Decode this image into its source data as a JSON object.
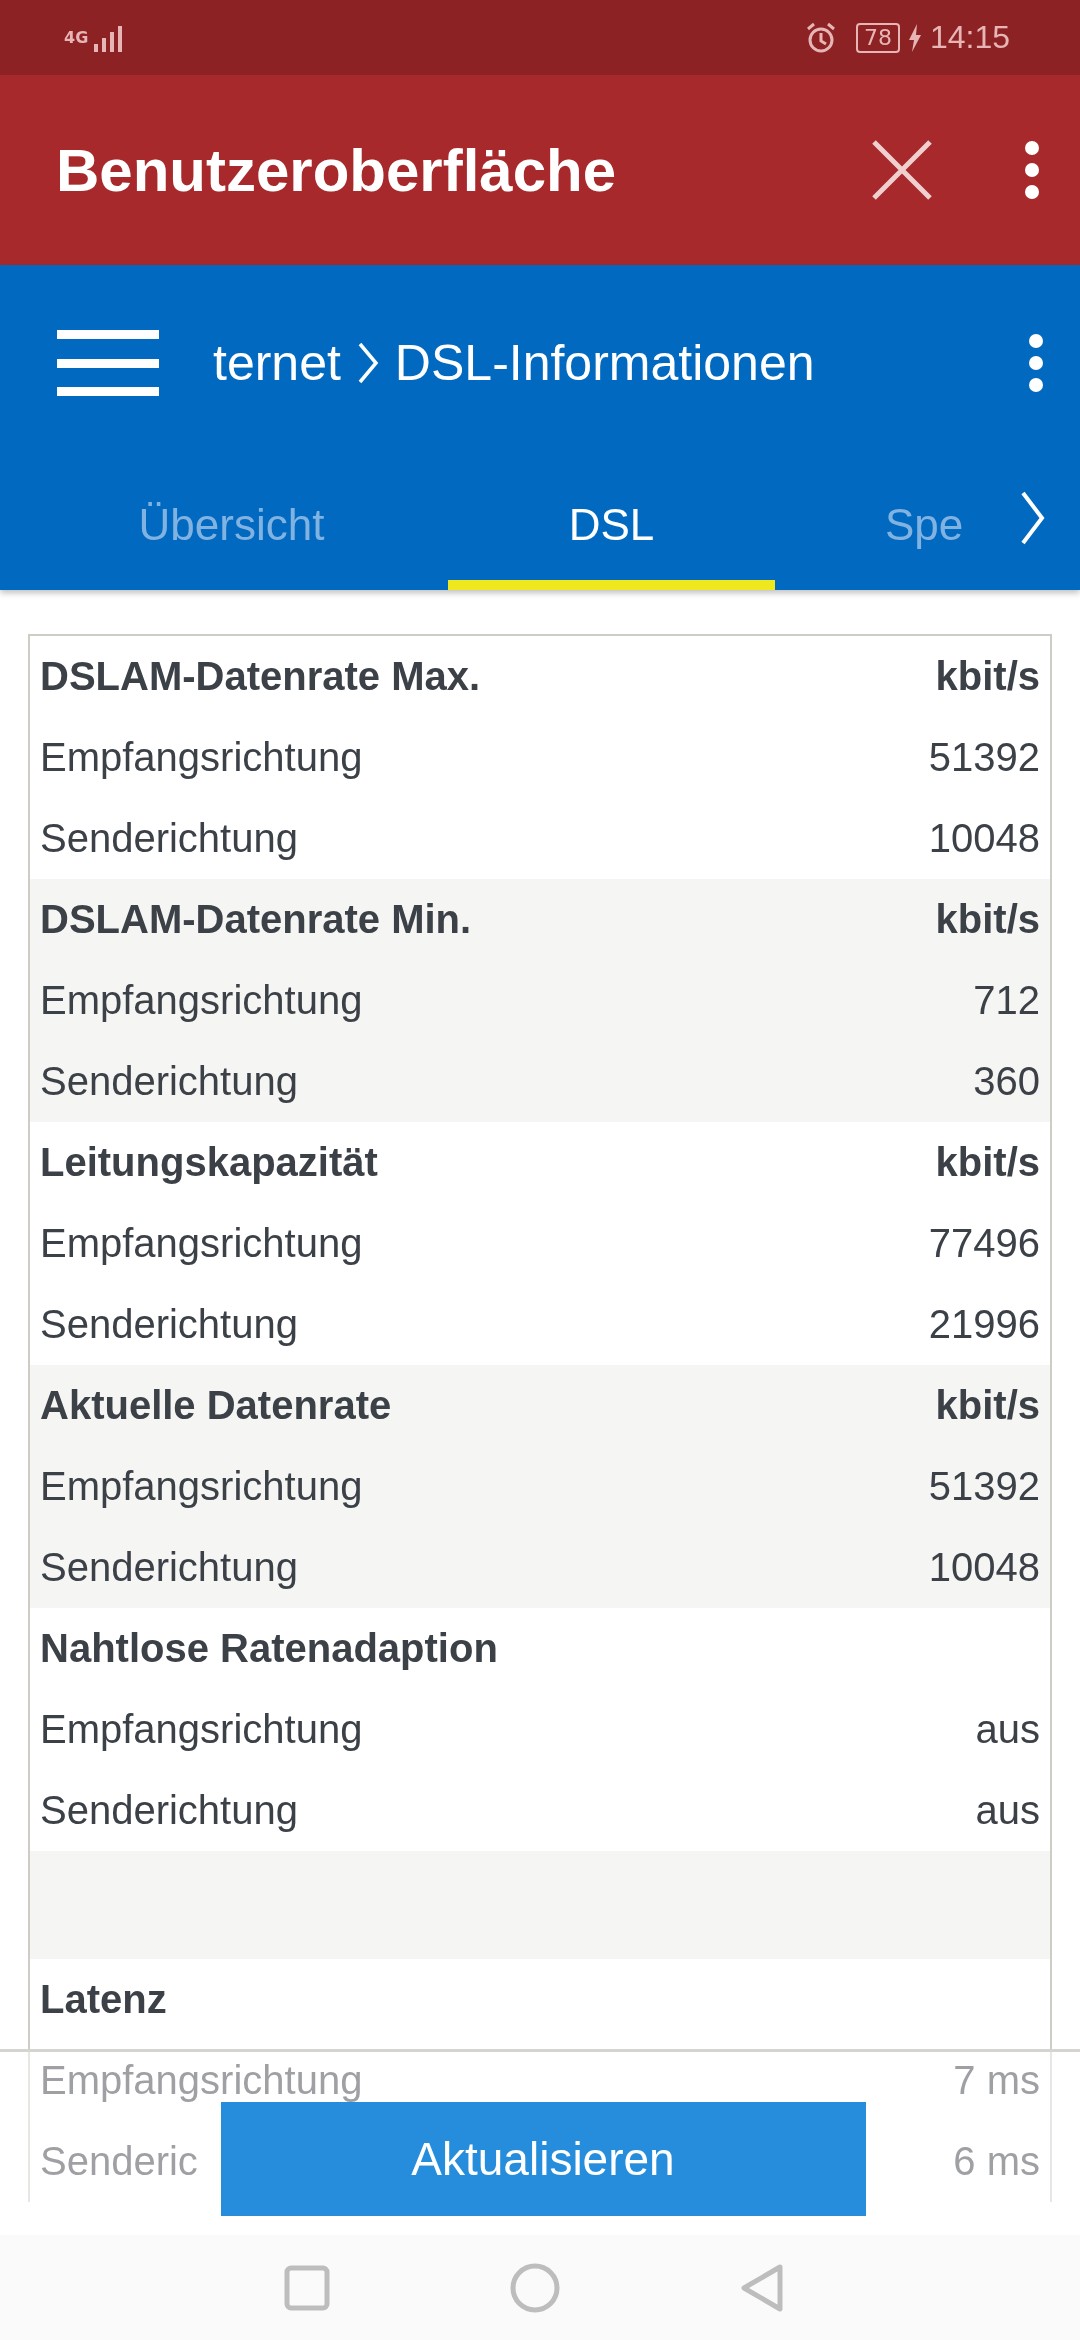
{
  "status_bar": {
    "network": "4G",
    "battery": "78",
    "time": "14:15"
  },
  "app_bar": {
    "title": "Benutzeroberfläche"
  },
  "breadcrumb": {
    "parent": "ternet",
    "current": "DSL-Informationen"
  },
  "tabs": [
    {
      "label": "Übersicht",
      "selected": false
    },
    {
      "label": "DSL",
      "selected": true
    },
    {
      "label": "Spe",
      "selected": false
    }
  ],
  "table": {
    "groups": [
      {
        "kind": "section",
        "title": "DSLAM-Datenrate Max.",
        "unit": "kbit/s",
        "rows": [
          {
            "label": "Empfangsrichtung",
            "value": "51392"
          },
          {
            "label": "Senderichtung",
            "value": "10048"
          }
        ]
      },
      {
        "kind": "section",
        "title": "DSLAM-Datenrate Min.",
        "unit": "kbit/s",
        "rows": [
          {
            "label": "Empfangsrichtung",
            "value": "712"
          },
          {
            "label": "Senderichtung",
            "value": "360"
          }
        ]
      },
      {
        "kind": "section",
        "title": "Leitungskapazität",
        "unit": "kbit/s",
        "rows": [
          {
            "label": "Empfangsrichtung",
            "value": "77496"
          },
          {
            "label": "Senderichtung",
            "value": "21996"
          }
        ]
      },
      {
        "kind": "section",
        "title": "Aktuelle Datenrate",
        "unit": "kbit/s",
        "rows": [
          {
            "label": "Empfangsrichtung",
            "value": "51392"
          },
          {
            "label": "Senderichtung",
            "value": "10048"
          }
        ]
      },
      {
        "kind": "section",
        "title": "Nahtlose Ratenadaption",
        "rows": [
          {
            "label": "Empfangsrichtung",
            "value": "aus"
          },
          {
            "label": "Senderichtung",
            "value": "aus"
          }
        ]
      },
      {
        "kind": "spacer"
      },
      {
        "kind": "section",
        "title": "Latenz",
        "rows": [
          {
            "label": "Empfangsrichtung",
            "value": "7 ms"
          },
          {
            "label": "Senderic",
            "value": "6 ms"
          }
        ]
      }
    ]
  },
  "refresh_button": "Aktualisieren"
}
